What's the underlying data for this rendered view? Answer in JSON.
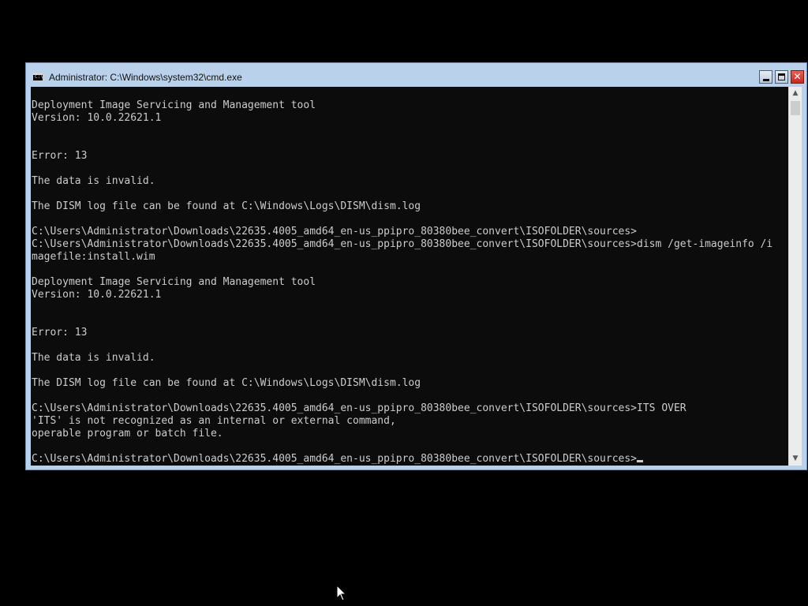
{
  "window": {
    "title": "Administrator: C:\\Windows\\system32\\cmd.exe",
    "icon": "cmd-icon",
    "icon_text": "C:\\",
    "buttons": {
      "minimize": "minimize-icon",
      "maximize": "maximize-icon",
      "close": "close-icon",
      "close_glyph": "✕"
    }
  },
  "console": {
    "lines": [
      "Deployment Image Servicing and Management tool",
      "Version: 10.0.22621.1",
      "",
      "",
      "Error: 13",
      "",
      "The data is invalid.",
      "",
      "The DISM log file can be found at C:\\Windows\\Logs\\DISM\\dism.log",
      "",
      "C:\\Users\\Administrator\\Downloads\\22635.4005_amd64_en-us_ppipro_80380bee_convert\\ISOFOLDER\\sources>",
      "C:\\Users\\Administrator\\Downloads\\22635.4005_amd64_en-us_ppipro_80380bee_convert\\ISOFOLDER\\sources>dism /get-imageinfo /i",
      "magefile:install.wim",
      "",
      "Deployment Image Servicing and Management tool",
      "Version: 10.0.22621.1",
      "",
      "",
      "Error: 13",
      "",
      "The data is invalid.",
      "",
      "The DISM log file can be found at C:\\Windows\\Logs\\DISM\\dism.log",
      "",
      "C:\\Users\\Administrator\\Downloads\\22635.4005_amd64_en-us_ppipro_80380bee_convert\\ISOFOLDER\\sources>ITS OVER",
      "'ITS' is not recognized as an internal or external command,",
      "operable program or batch file.",
      "",
      "C:\\Users\\Administrator\\Downloads\\22635.4005_amd64_en-us_ppipro_80380bee_convert\\ISOFOLDER\\sources>"
    ]
  },
  "scrollbar": {
    "up_arrow": "▲",
    "down_arrow": "▼"
  },
  "colors": {
    "desktop": "#000000",
    "console_background": "#0c0c0c",
    "console_text": "#cccccc",
    "window_frame": "#b9d1ea",
    "close_button": "#c3291f"
  },
  "pointer": "mouse-pointer-icon"
}
